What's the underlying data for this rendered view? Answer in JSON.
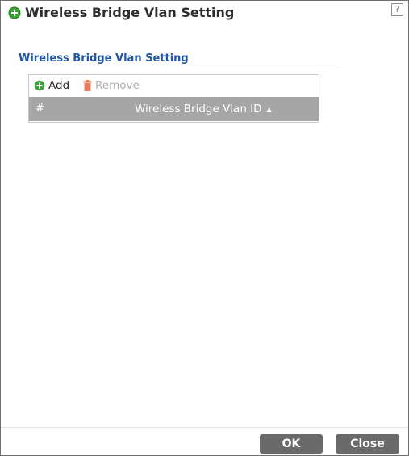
{
  "dialog": {
    "title": "Wireless Bridge Vlan Setting",
    "help_label": "?"
  },
  "section": {
    "title": "Wireless Bridge Vlan Setting"
  },
  "toolbar": {
    "add_label": "Add",
    "remove_label": "Remove"
  },
  "table": {
    "columns": [
      "#",
      "Wireless Bridge Vlan ID"
    ],
    "sort_indicator": "▲",
    "rows": []
  },
  "footer": {
    "ok_label": "OK",
    "close_label": "Close"
  },
  "colors": {
    "accent": "#1f56a6",
    "add_icon": "#3aa334",
    "remove_icon": "#e87b5c",
    "header_bg": "#a6a6a6",
    "button_bg": "#6a6a6a"
  }
}
